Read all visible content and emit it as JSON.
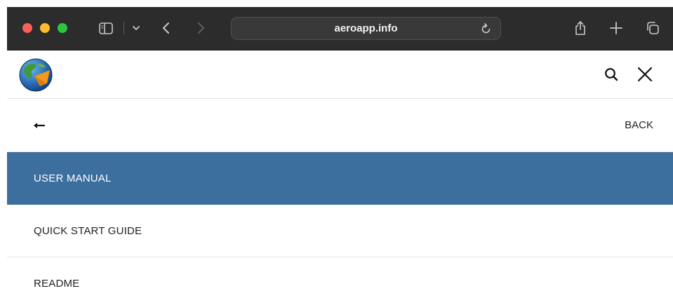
{
  "browser": {
    "url": "aeroapp.info",
    "icons": [
      "sidebar-icon",
      "chevron-down-icon",
      "back-icon",
      "forward-icon",
      "reload-icon",
      "share-icon",
      "new-tab-icon",
      "tabs-overview-icon"
    ]
  },
  "header": {
    "logo": "globe-logo",
    "icons": [
      "search-icon",
      "close-icon"
    ]
  },
  "menu": {
    "back_label": "BACK",
    "items": [
      {
        "label": "USER MANUAL",
        "active": true
      },
      {
        "label": "QUICK START GUIDE",
        "active": false
      },
      {
        "label": "README",
        "active": false
      }
    ]
  },
  "colors": {
    "active_bg": "#3c6e9e",
    "toolbar_bg": "#2c2c2c"
  }
}
